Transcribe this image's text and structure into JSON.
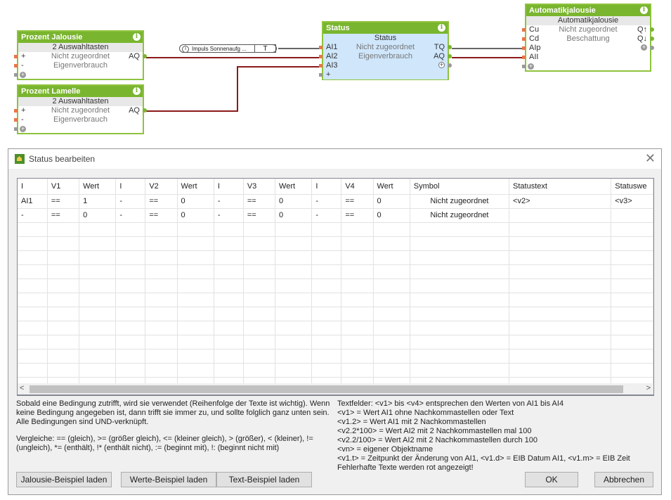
{
  "canvas": {
    "block_jalousie": {
      "title": "Prozent Jalousie",
      "subtitle": "2 Auswahltasten",
      "row1": {
        "left": "+",
        "center": "Nicht zugeordnet",
        "right": "AQ"
      },
      "row2": {
        "left": "-",
        "center": "Eigenverbrauch"
      }
    },
    "block_lamelle": {
      "title": "Prozent Lamelle",
      "subtitle": "2 Auswahltasten",
      "row1": {
        "left": "+",
        "center": "Nicht zugeordnet",
        "right": "AQ"
      },
      "row2": {
        "left": "-",
        "center": "Eigenverbrauch"
      }
    },
    "impuls": {
      "info": "i",
      "label": "Impuls Sonnenaufg ...",
      "t": "T"
    },
    "block_status": {
      "title": "Status",
      "subtitle": "Status",
      "row1": {
        "left": "AI1",
        "center": "Nicht zugeordnet",
        "right": "TQ"
      },
      "row2": {
        "left": "AI2",
        "center": "Eigenverbrauch",
        "right": "AQ"
      },
      "row3": {
        "left": "AI3"
      }
    },
    "block_auto": {
      "title": "Automatikjalousie",
      "subtitle": "Automatikjalousie",
      "row1": {
        "left": "Cu",
        "center": "Nicht zugeordnet",
        "right": "Q↑"
      },
      "row2": {
        "left": "Cd",
        "center": "Beschattung",
        "right": "Q↓"
      },
      "row3": {
        "left": "AIp"
      },
      "row4": {
        "left": "AII"
      }
    },
    "info_icon": "i"
  },
  "dialog": {
    "title": "Status bearbeiten",
    "close": "✕",
    "columns": [
      "I",
      "V1",
      "Wert",
      "I",
      "V2",
      "Wert",
      "I",
      "V3",
      "Wert",
      "I",
      "V4",
      "Wert",
      "Symbol",
      "Statustext",
      "Statuswe"
    ],
    "rows": [
      [
        "AI1",
        "==",
        "1",
        "-",
        "==",
        "0",
        "-",
        "==",
        "0",
        "-",
        "==",
        "0",
        "Nicht zugeordnet",
        "<v2>",
        "<v3>"
      ],
      [
        "-",
        "==",
        "0",
        "-",
        "==",
        "0",
        "-",
        "==",
        "0",
        "-",
        "==",
        "0",
        "Nicht zugeordnet",
        "",
        ""
      ]
    ],
    "scroll_left": "<",
    "scroll_right": ">",
    "help_left_1": "Sobald eine Bedingung zutrifft, wird sie verwendet (Reihenfolge der Texte ist wichtig). Wenn\nkeine Bedingung angegeben ist, dann trifft sie immer zu, und sollte folglich ganz unten sein.\nAlle Bedingungen sind UND-verknüpft.",
    "help_left_2": "Vergleiche: == (gleich), >= (größer gleich), <= (kleiner gleich), > (größer), < (kleiner), !=\n(ungleich), *= (enthält), !* (enthält nicht), := (beginnt mit), !: (beginnt nicht mit)",
    "help_right": "Textfelder: <v1> bis <v4> entsprechen den Werten von AI1 bis AI4\n<v1> = Wert AI1 ohne Nachkommastellen oder Text\n<v1.2> = Wert AI1 mit 2 Nachkommastellen\n<v2.2*100> = Wert AI2 mit 2 Nachkommastellen mal 100\n<v2.2/100> = Wert AI2 mit 2 Nachkommastellen durch 100\n<vn> = eigener Objektname\n<v1.t> = Zeitpunkt der Änderung von AI1, <v1.d> = EIB Datum AI1, <v1.m> = EIB Zeit\nFehlerhafte Texte werden rot angezeigt!",
    "buttons": {
      "jalousie": "Jalousie-Beispiel laden",
      "werte": "Werte-Beispiel laden",
      "text": "Text-Beispiel laden",
      "ok": "OK",
      "cancel": "Abbrechen"
    }
  },
  "colors": {
    "block_green": "#7ab52f",
    "status_blue": "#cfe6fb",
    "wire_red": "#8b1a1a"
  }
}
